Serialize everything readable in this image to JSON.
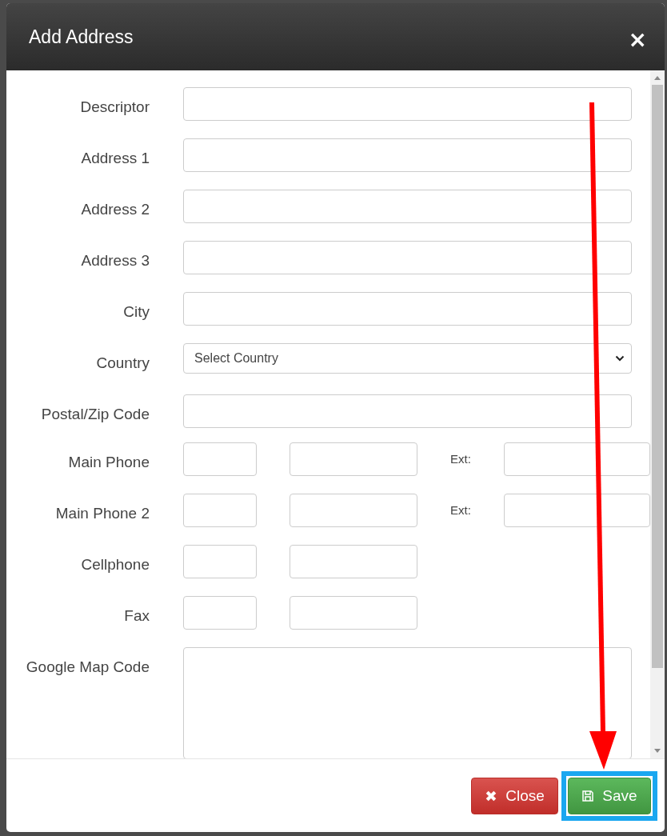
{
  "dialog": {
    "title": "Add Address",
    "close_icon": "×"
  },
  "fields": [
    {
      "label": "Descriptor",
      "kind": "text"
    },
    {
      "label": "Address 1",
      "kind": "text"
    },
    {
      "label": "Address 2",
      "kind": "text"
    },
    {
      "label": "Address 3",
      "kind": "text"
    },
    {
      "label": "City",
      "kind": "text"
    },
    {
      "label": "Country",
      "kind": "select",
      "value": "Select Country"
    },
    {
      "label": "Postal/Zip Code",
      "kind": "text"
    },
    {
      "label": "Main Phone",
      "kind": "phone",
      "ext_label": "Ext:"
    },
    {
      "label": "Main Phone 2",
      "kind": "phone",
      "ext_label": "Ext:"
    },
    {
      "label": "Cellphone",
      "kind": "phone"
    },
    {
      "label": "Fax",
      "kind": "phone"
    },
    {
      "label": "Google Map Code",
      "kind": "textarea"
    }
  ],
  "buttons": [
    {
      "label": "Close",
      "kind": "close"
    },
    {
      "label": "Save",
      "kind": "save"
    }
  ]
}
